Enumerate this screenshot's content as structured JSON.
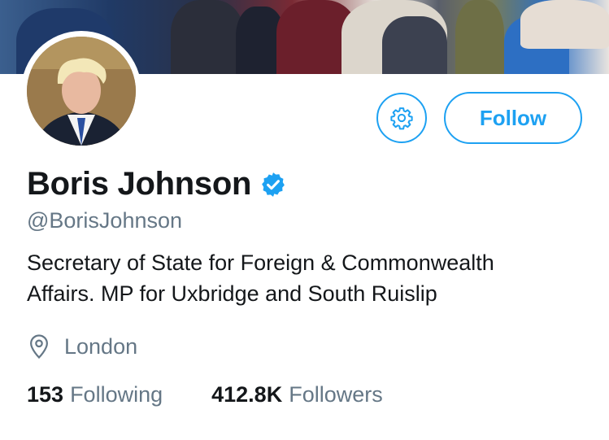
{
  "profile": {
    "name": "Boris Johnson",
    "handle": "@BorisJohnson",
    "bio_line1": "Secretary of State for Foreign & Commonwealth",
    "bio_line2": "Affairs. MP for Uxbridge and South Ruislip",
    "location": "London"
  },
  "actions": {
    "follow_label": "Follow"
  },
  "stats": {
    "following_count": "153",
    "following_label": "Following",
    "followers_count": "412.8K",
    "followers_label": "Followers"
  },
  "icons": {
    "settings": "gear-icon",
    "verified": "verified-badge-icon",
    "location": "location-pin-icon"
  },
  "colors": {
    "accent": "#1da1f2",
    "text_primary": "#14171a",
    "text_secondary": "#657786"
  }
}
